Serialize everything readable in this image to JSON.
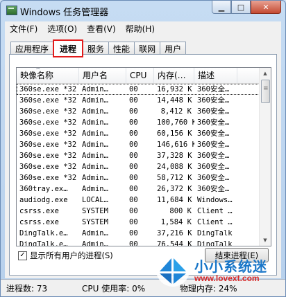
{
  "window": {
    "title": "Windows 任务管理器"
  },
  "menu": [
    {
      "label": "文件(F)"
    },
    {
      "label": "选项(O)"
    },
    {
      "label": "查看(V)"
    },
    {
      "label": "帮助(H)"
    }
  ],
  "tabs": [
    {
      "label": "应用程序"
    },
    {
      "label": "进程"
    },
    {
      "label": "服务"
    },
    {
      "label": "性能"
    },
    {
      "label": "联网"
    },
    {
      "label": "用户"
    }
  ],
  "active_tab": "进程",
  "columns": [
    {
      "label": "映像名称"
    },
    {
      "label": "用户名"
    },
    {
      "label": "CPU"
    },
    {
      "label": "内存(…"
    },
    {
      "label": "描述"
    }
  ],
  "rows": [
    {
      "name": "360se.exe *32",
      "user": "Admin…",
      "cpu": "00",
      "mem": "16,932 K",
      "desc": "360安全…"
    },
    {
      "name": "360se.exe *32",
      "user": "Admin…",
      "cpu": "00",
      "mem": "14,448 K",
      "desc": "360安全…"
    },
    {
      "name": "360se.exe *32",
      "user": "Admin…",
      "cpu": "00",
      "mem": "8,412 K",
      "desc": "360安全…"
    },
    {
      "name": "360se.exe *32",
      "user": "Admin…",
      "cpu": "00",
      "mem": "100,760 K",
      "desc": "360安全…"
    },
    {
      "name": "360se.exe *32",
      "user": "Admin…",
      "cpu": "00",
      "mem": "60,156 K",
      "desc": "360安全…"
    },
    {
      "name": "360se.exe *32",
      "user": "Admin…",
      "cpu": "00",
      "mem": "146,616 K",
      "desc": "360安全…"
    },
    {
      "name": "360se.exe *32",
      "user": "Admin…",
      "cpu": "00",
      "mem": "37,328 K",
      "desc": "360安全…"
    },
    {
      "name": "360se.exe *32",
      "user": "Admin…",
      "cpu": "00",
      "mem": "24,088 K",
      "desc": "360安全…"
    },
    {
      "name": "360se.exe *32",
      "user": "Admin…",
      "cpu": "00",
      "mem": "58,712 K",
      "desc": "360安全…"
    },
    {
      "name": "360tray.ex…",
      "user": "Admin…",
      "cpu": "00",
      "mem": "26,372 K",
      "desc": "360安全…"
    },
    {
      "name": "audiodg.exe",
      "user": "LOCAL…",
      "cpu": "00",
      "mem": "11,684 K",
      "desc": "Windows…"
    },
    {
      "name": "csrss.exe",
      "user": "SYSTEM",
      "cpu": "00",
      "mem": "800 K",
      "desc": "Client …"
    },
    {
      "name": "csrss.exe",
      "user": "SYSTEM",
      "cpu": "00",
      "mem": "1,584 K",
      "desc": "Client …"
    },
    {
      "name": "DingTalk.e…",
      "user": "Admin…",
      "cpu": "00",
      "mem": "37,216 K",
      "desc": "DingTalk"
    },
    {
      "name": "DingTalk.e…",
      "user": "Admin…",
      "cpu": "00",
      "mem": "76,544 K",
      "desc": "DingTalk"
    }
  ],
  "show_all_users": {
    "label": "显示所有用户的进程(S)",
    "checked": "✓"
  },
  "end_process_button": "结束进程(E)",
  "status": {
    "processes": "进程数: 73",
    "cpu": "CPU 使用率: 0%",
    "memory": "物理内存: 24%"
  },
  "watermark": {
    "name": "小小系统迷",
    "url": "www.lovext.com"
  }
}
